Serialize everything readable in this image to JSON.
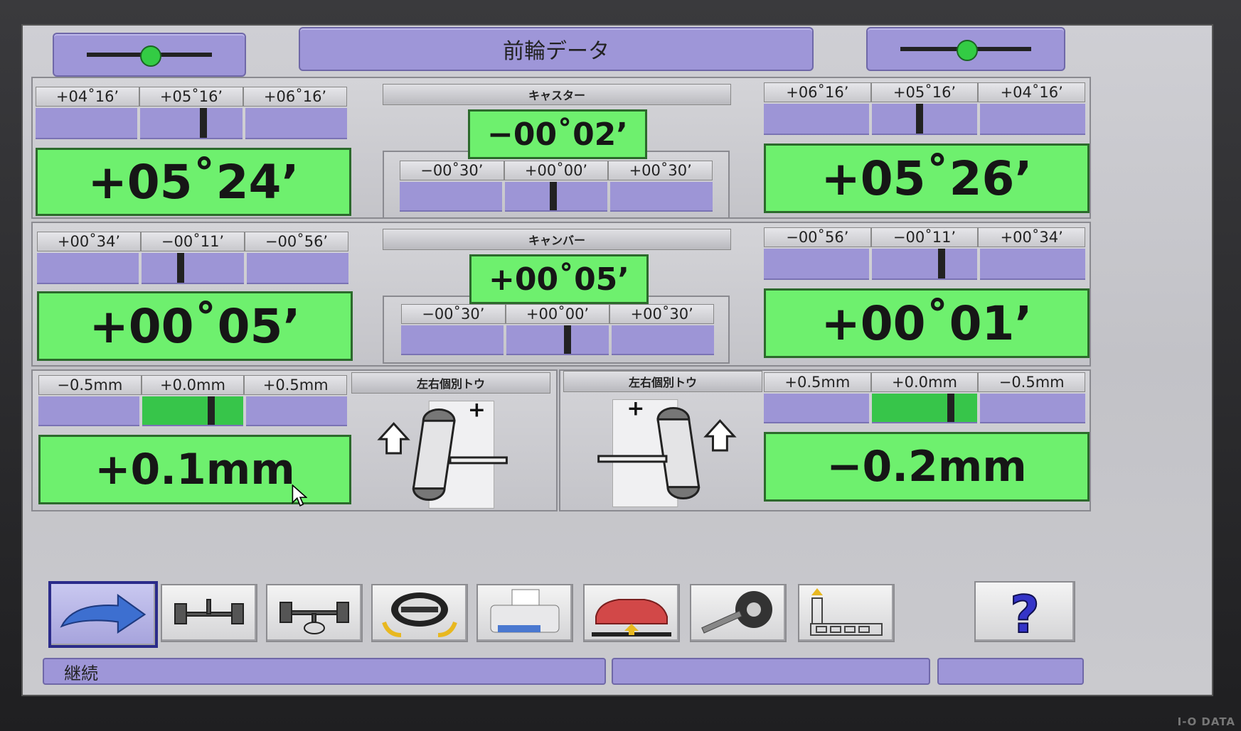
{
  "title": "前輪データ",
  "caster": {
    "label": "キャスター",
    "center_value": "−00˚02’",
    "left": {
      "ticks": [
        "+04˚16’",
        "+05˚16’",
        "+06˚16’"
      ],
      "value": "+05˚24’"
    },
    "right": {
      "ticks": [
        "+06˚16’",
        "+05˚16’",
        "+04˚16’"
      ],
      "value": "+05˚26’"
    },
    "center_ticks": [
      "−00˚30’",
      "+00˚00’",
      "+00˚30’"
    ]
  },
  "camber": {
    "label": "キャンバー",
    "center_value": "+00˚05’",
    "left": {
      "ticks": [
        "+00˚34’",
        "−00˚11’",
        "−00˚56’"
      ],
      "value": "+00˚05’"
    },
    "right": {
      "ticks": [
        "−00˚56’",
        "−00˚11’",
        "+00˚34’"
      ],
      "value": "+00˚01’"
    },
    "center_ticks": [
      "−00˚30’",
      "+00˚00’",
      "+00˚30’"
    ]
  },
  "toe": {
    "left_label": "左右個別トウ",
    "right_label": "左右個別トウ",
    "left": {
      "ticks": [
        "−0.5mm",
        "+0.0mm",
        "+0.5mm"
      ],
      "value": "+0.1mm"
    },
    "right": {
      "ticks": [
        "+0.5mm",
        "+0.0mm",
        "−0.5mm"
      ],
      "value": "−0.2mm"
    },
    "plus_sign": "+"
  },
  "toolbar": {
    "icons": [
      "continue-arrow-icon",
      "axle-icon",
      "steering-axle-icon",
      "steering-wheel-icon",
      "printer-icon",
      "car-lift-icon",
      "wrench-wheel-icon",
      "level-icon",
      "help-icon"
    ],
    "help_label": "?"
  },
  "status": {
    "text": "継続"
  },
  "brand": "I-O DATA",
  "colors": {
    "accent": "#9e96d8",
    "value_green": "#6ef06e"
  }
}
